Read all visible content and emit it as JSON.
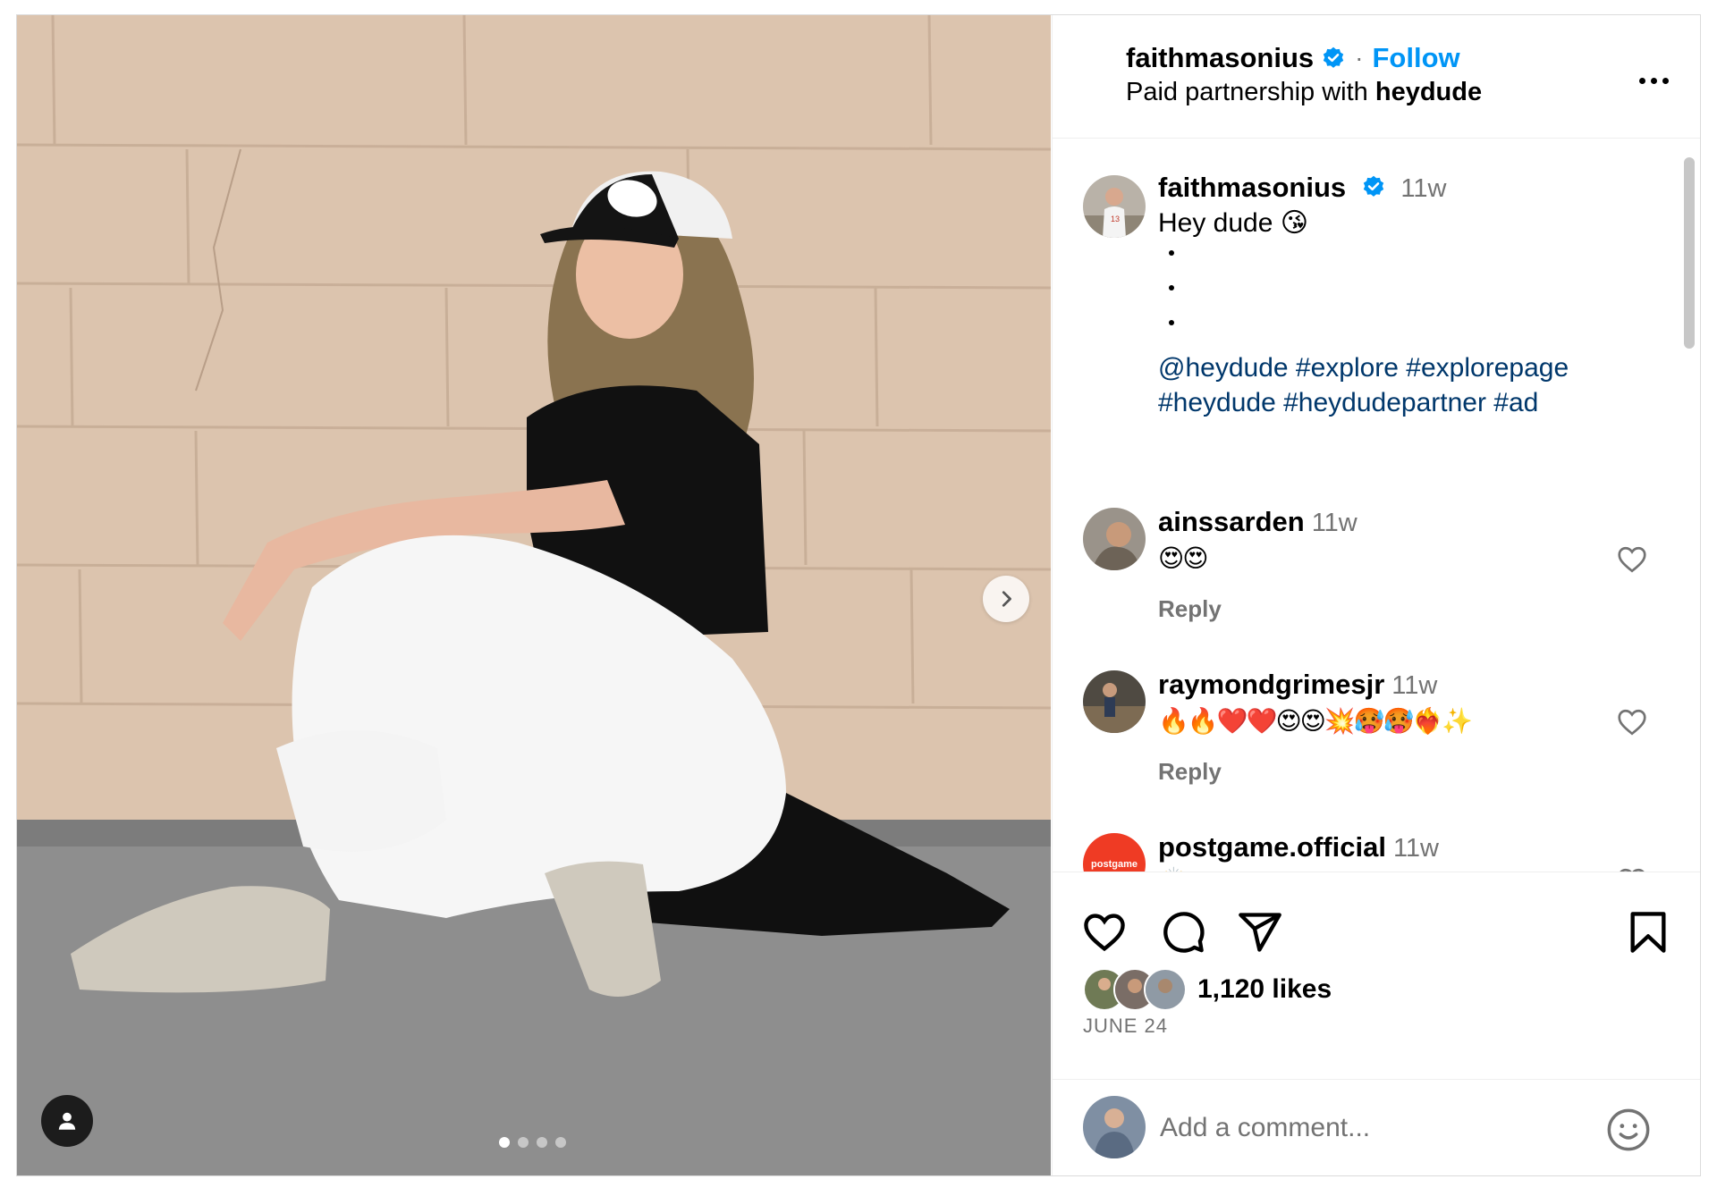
{
  "header": {
    "username": "faithmasonius",
    "separator": "·",
    "follow_label": "Follow",
    "partnership_prefix": "Paid partnership with ",
    "partner": "heydude"
  },
  "caption": {
    "username": "faithmasonius",
    "time": "11w",
    "text": "Hey dude 😘",
    "hashtags": "@heydude #explore #explorepage #heydude #heydudepartner #ad"
  },
  "comments": [
    {
      "username": "ainssarden",
      "time": "11w",
      "text": "😍😍",
      "reply_label": "Reply"
    },
    {
      "username": "raymondgrimesjr",
      "time": "11w",
      "text": "🔥🔥❤️❤️😍😍💥🥵🥵❤️‍🔥✨",
      "reply_label": "Reply"
    },
    {
      "username": "postgame.official",
      "time": "11w",
      "text": "🙌",
      "avatar_text": "postgame"
    }
  ],
  "likes": {
    "label": "1,120 likes"
  },
  "date": "JUNE 24",
  "add_comment": {
    "placeholder": "Add a comment..."
  },
  "colors": {
    "accent": "#0095f6",
    "hashtag": "#00376b",
    "muted": "#737373",
    "postgame": "#ef3b24"
  },
  "carousel": {
    "total": 4,
    "active": 1
  },
  "icons": [
    "verified-badge-icon",
    "more-options-icon",
    "next-arrow-icon",
    "user-tag-icon",
    "heart-icon",
    "comment-icon",
    "share-icon",
    "bookmark-icon",
    "emoji-icon"
  ]
}
